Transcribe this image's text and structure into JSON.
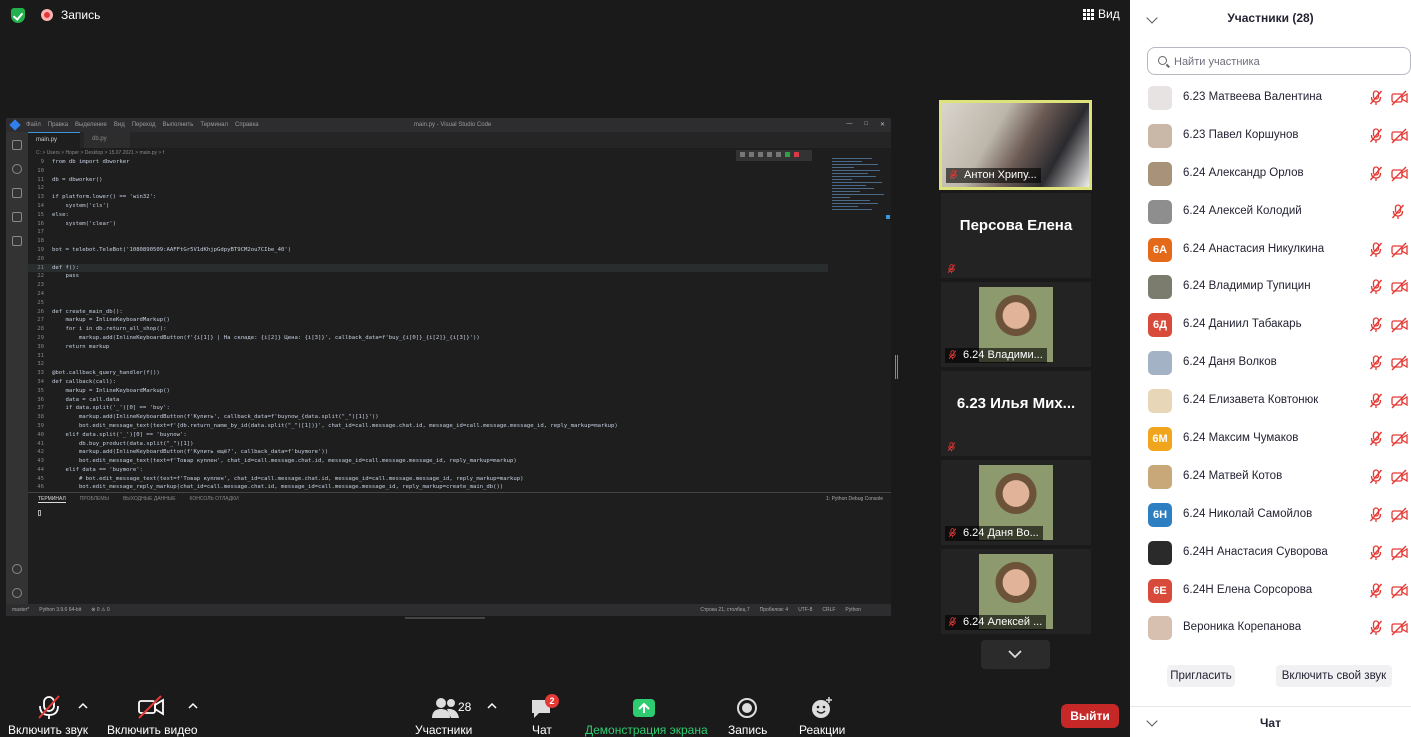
{
  "topbar": {
    "record_label": "Запись",
    "view_label": "Вид"
  },
  "vscode": {
    "menu": [
      "Файл",
      "Правка",
      "Выделение",
      "Вид",
      "Переход",
      "Выполнить",
      "Терминал",
      "Справка"
    ],
    "window_title": "main.py - Visual Studio Code",
    "tabs": [
      "main.py",
      "db.py"
    ],
    "breadcrumb": "C: > Users > Hoper > Desktop > 15.07.2021 > main.py > f",
    "panel_tabs": [
      "ТЕРМИНАЛ",
      "ПРОБЛЕМЫ",
      "ВЫХОДНЫЕ ДАННЫЕ",
      "КОНСОЛЬ ОТЛАДКИ"
    ],
    "panel_right": "1: Python Debug Console",
    "status_left": [
      "master*",
      "Python 3.9.6 64-bit",
      "⊗ 0 ⚠ 0"
    ],
    "status_right": [
      "Строка 21, столбец 7",
      "Пробелов: 4",
      "UTF-8",
      "CRLF",
      "Python"
    ],
    "code": [
      {
        "n": "9",
        "t": "from db import dbworker"
      },
      {
        "n": "10",
        "t": ""
      },
      {
        "n": "11",
        "t": "db = dbworker()"
      },
      {
        "n": "12",
        "t": ""
      },
      {
        "n": "13",
        "t": "if platform.lower() == 'win32':"
      },
      {
        "n": "14",
        "t": "    system('cls')"
      },
      {
        "n": "15",
        "t": "else:"
      },
      {
        "n": "16",
        "t": "    system('clear')"
      },
      {
        "n": "17",
        "t": ""
      },
      {
        "n": "18",
        "t": ""
      },
      {
        "n": "19",
        "t": "bot = telebot.TeleBot('1080890509:AAFFtGr5V1dKhjpGdpyBT9CM2ou7CIbe_40')"
      },
      {
        "n": "20",
        "t": ""
      },
      {
        "n": "21",
        "t": "def f():"
      },
      {
        "n": "22",
        "t": "    pass"
      },
      {
        "n": "23",
        "t": ""
      },
      {
        "n": "24",
        "t": ""
      },
      {
        "n": "25",
        "t": ""
      },
      {
        "n": "26",
        "t": "def create_main_db():"
      },
      {
        "n": "27",
        "t": "    markup = InlineKeyboardMarkup()"
      },
      {
        "n": "28",
        "t": "    for i in db.return_all_shop():"
      },
      {
        "n": "29",
        "t": "        markup.add(InlineKeyboardButton(f'{i[1]} | На складе: {i[2]} Цена: {i[3]}', callback_data=f'buy_{i[0]}_{i[2]}_{i[3]}'))"
      },
      {
        "n": "30",
        "t": "    return markup"
      },
      {
        "n": "31",
        "t": ""
      },
      {
        "n": "32",
        "t": ""
      },
      {
        "n": "33",
        "t": "@bot.callback_query_handler(f())"
      },
      {
        "n": "34",
        "t": "def callback(call):"
      },
      {
        "n": "35",
        "t": "    markup = InlineKeyboardMarkup()"
      },
      {
        "n": "36",
        "t": "    data = call.data"
      },
      {
        "n": "37",
        "t": "    if data.split('_')[0] == 'buy':"
      },
      {
        "n": "38",
        "t": "        markup.add(InlineKeyboardButton(f'Купить', callback_data=f'buynow_{data.split(\"_\")[1]}'))"
      },
      {
        "n": "39",
        "t": "        bot.edit_message_text(text=f'{db.return_name_by_id(data.split(\"_\")[1])}', chat_id=call.message.chat.id, message_id=call.message.message_id, reply_markup=markup)"
      },
      {
        "n": "40",
        "t": "    elif data.split('_')[0] == 'buynow':"
      },
      {
        "n": "41",
        "t": "        db.buy_product(data.split(\"_\")[1])"
      },
      {
        "n": "42",
        "t": "        markup.add(InlineKeyboardButton(f'Купить ещё?', callback_data=f'buymore'))"
      },
      {
        "n": "43",
        "t": "        bot.edit_message_text(text=f'Товар куплен', chat_id=call.message.chat.id, message_id=call.message.message_id, reply_markup=markup)"
      },
      {
        "n": "44",
        "t": "    elif data == 'buymore':"
      },
      {
        "n": "45",
        "t": "        # bot.edit_message_text(text=f'Товар куплен', chat_id=call.message.chat.id, message_id=call.message.message_id, reply_markup=markup)"
      },
      {
        "n": "46",
        "t": "        bot.edit_message_reply_markup(chat_id=call.message.chat.id, message_id=call.message.message_id, reply_markup=create_main_db())"
      }
    ]
  },
  "tiles": [
    {
      "name": "Антон Хрипу...",
      "type": "video-active"
    },
    {
      "name": "Персова Елена",
      "type": "name-only"
    },
    {
      "name": "6.24 Владими...",
      "type": "video"
    },
    {
      "name": "6.23  Илья Мих...",
      "type": "name-only"
    },
    {
      "name": "6.24 Даня Во...",
      "type": "video"
    },
    {
      "name": "6.24 Алексей ...",
      "type": "video"
    }
  ],
  "toolbar": {
    "mute_label": "Включить звук",
    "video_label": "Включить видео",
    "participants_label": "Участники",
    "participants_count": "28",
    "chat_label": "Чат",
    "chat_badge": "2",
    "share_label": "Демонстрация экрана",
    "record_label": "Запись",
    "reactions_label": "Реакции",
    "leave_label": "Выйти"
  },
  "participants_panel": {
    "title": "Участники (28)",
    "search_placeholder": "Найти участника",
    "invite_label": "Пригласить",
    "unmute_self_label": "Включить свой звук",
    "chat_title": "Чат",
    "list": [
      {
        "name": "6.23 Матвеева Валентина",
        "avatar": "",
        "avatar_color": "#e8e3e3",
        "video_muted": true
      },
      {
        "name": "6.23 Павел Коршунов",
        "avatar": "",
        "avatar_color": "#c9b8a8",
        "video_muted": true
      },
      {
        "name": "6.24 Александр Орлов",
        "avatar": "",
        "avatar_color": "#a89279",
        "video_muted": true
      },
      {
        "name": "6.24 Алексей Колодий",
        "avatar": "",
        "avatar_color": "#8e8e8e",
        "video_muted": false
      },
      {
        "name": "6.24 Анастасия Никулкина",
        "avatar": "6А",
        "avatar_color": "#e46a1a",
        "video_muted": true
      },
      {
        "name": "6.24 Владимир Тупицин",
        "avatar": "",
        "avatar_color": "#7c7c6e",
        "video_muted": true
      },
      {
        "name": "6.24 Даниил Табакарь",
        "avatar": "6Д",
        "avatar_color": "#d84a3a",
        "video_muted": true
      },
      {
        "name": "6.24 Даня Волков",
        "avatar": "",
        "avatar_color": "#a4b2c6",
        "video_muted": true
      },
      {
        "name": "6.24 Елизавета Ковтонюк",
        "avatar": "",
        "avatar_color": "#e8d6b8",
        "video_muted": true
      },
      {
        "name": "6.24 Максим Чумаков",
        "avatar": "6М",
        "avatar_color": "#f0a51c",
        "video_muted": true
      },
      {
        "name": "6.24 Матвей Котов",
        "avatar": "",
        "avatar_color": "#c8a878",
        "video_muted": true
      },
      {
        "name": "6.24 Николай Самойлов",
        "avatar": "6Н",
        "avatar_color": "#2d7fc1",
        "video_muted": true
      },
      {
        "name": "6.24Н Анастасия Суворова",
        "avatar": "",
        "avatar_color": "#2a2a2a",
        "video_muted": true
      },
      {
        "name": "6.24Н Елена Сорсорова",
        "avatar": "6Е",
        "avatar_color": "#d84a3a",
        "video_muted": true
      },
      {
        "name": "Вероника Корепанова",
        "avatar": "",
        "avatar_color": "#d8c0b0",
        "video_muted": true
      }
    ]
  },
  "colors": {
    "accent_green": "#22b14c",
    "muted_red": "#e53935",
    "leave_red": "#c62828",
    "active_border": "#dde27a"
  }
}
